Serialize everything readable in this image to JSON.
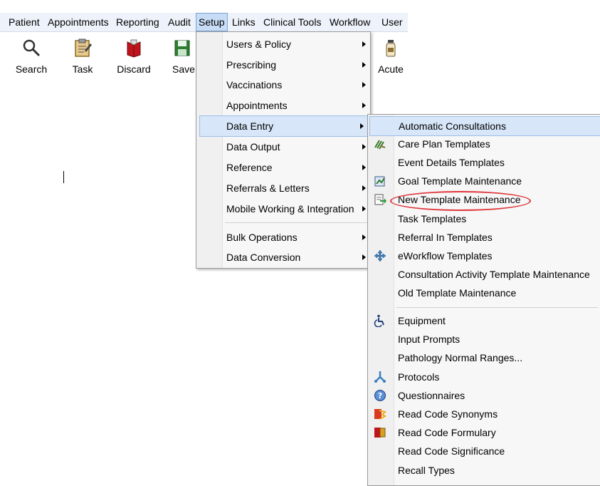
{
  "menubar": {
    "items": [
      "Patient",
      "Appointments",
      "Reporting",
      "Audit",
      "Setup",
      "Links",
      "Clinical Tools",
      "Workflow",
      "User"
    ],
    "active": "Setup"
  },
  "toolbar": {
    "buttons": [
      {
        "label": "Search",
        "icon": "magnifier-icon"
      },
      {
        "label": "Task",
        "icon": "clipboard-icon"
      },
      {
        "label": "Discard",
        "icon": "red-book-icon"
      },
      {
        "label": "Save",
        "icon": "floppy-disk-icon"
      },
      {
        "label": "Acute",
        "icon": "medicine-bottle-icon"
      }
    ]
  },
  "setup_menu": {
    "items": [
      {
        "label": "Users & Policy",
        "submenu": true
      },
      {
        "label": "Prescribing",
        "submenu": true
      },
      {
        "label": "Vaccinations",
        "submenu": true
      },
      {
        "label": "Appointments",
        "submenu": true
      },
      {
        "label": "Data Entry",
        "submenu": true,
        "highlighted": true
      },
      {
        "label": "Data Output",
        "submenu": true
      },
      {
        "label": "Reference",
        "submenu": true
      },
      {
        "label": "Referrals & Letters",
        "submenu": true
      },
      {
        "label": "Mobile Working & Integration",
        "submenu": true
      },
      {
        "label": "Bulk Operations",
        "submenu": true
      },
      {
        "label": "Data Conversion",
        "submenu": true
      }
    ]
  },
  "data_entry_submenu": {
    "items": [
      {
        "label": "Automatic Consultations",
        "icon": "",
        "highlighted": true
      },
      {
        "label": "Care Plan Templates",
        "icon": "care-plan-icon"
      },
      {
        "label": "Event Details Templates",
        "icon": ""
      },
      {
        "label": "Goal Template Maintenance",
        "icon": "goal-template-icon"
      },
      {
        "label": "New Template Maintenance",
        "icon": "template-arrow-icon",
        "circled": true
      },
      {
        "label": "Task Templates",
        "icon": ""
      },
      {
        "label": "Referral In Templates",
        "icon": ""
      },
      {
        "label": "eWorkflow Templates",
        "icon": "workflow-arrows-icon"
      },
      {
        "label": "Consultation Activity Template Maintenance",
        "icon": ""
      },
      {
        "label": "Old Template Maintenance",
        "icon": ""
      },
      {
        "label": "Equipment",
        "icon": "wheelchair-icon"
      },
      {
        "label": "Input Prompts",
        "icon": ""
      },
      {
        "label": "Pathology Normal Ranges...",
        "icon": ""
      },
      {
        "label": "Protocols",
        "icon": "protocol-flow-icon"
      },
      {
        "label": "Questionnaires",
        "icon": "question-icon"
      },
      {
        "label": "Read Code Synonyms",
        "icon": "read-code-synonym-icon"
      },
      {
        "label": "Read Code Formulary",
        "icon": "read-code-formulary-icon"
      },
      {
        "label": "Read Code Significance",
        "icon": ""
      },
      {
        "label": "Recall Types",
        "icon": ""
      }
    ]
  },
  "colors": {
    "menubar_bg": "#eef3fb",
    "highlight": "#d7e6f8",
    "annotation_circle": "#e0383c"
  }
}
